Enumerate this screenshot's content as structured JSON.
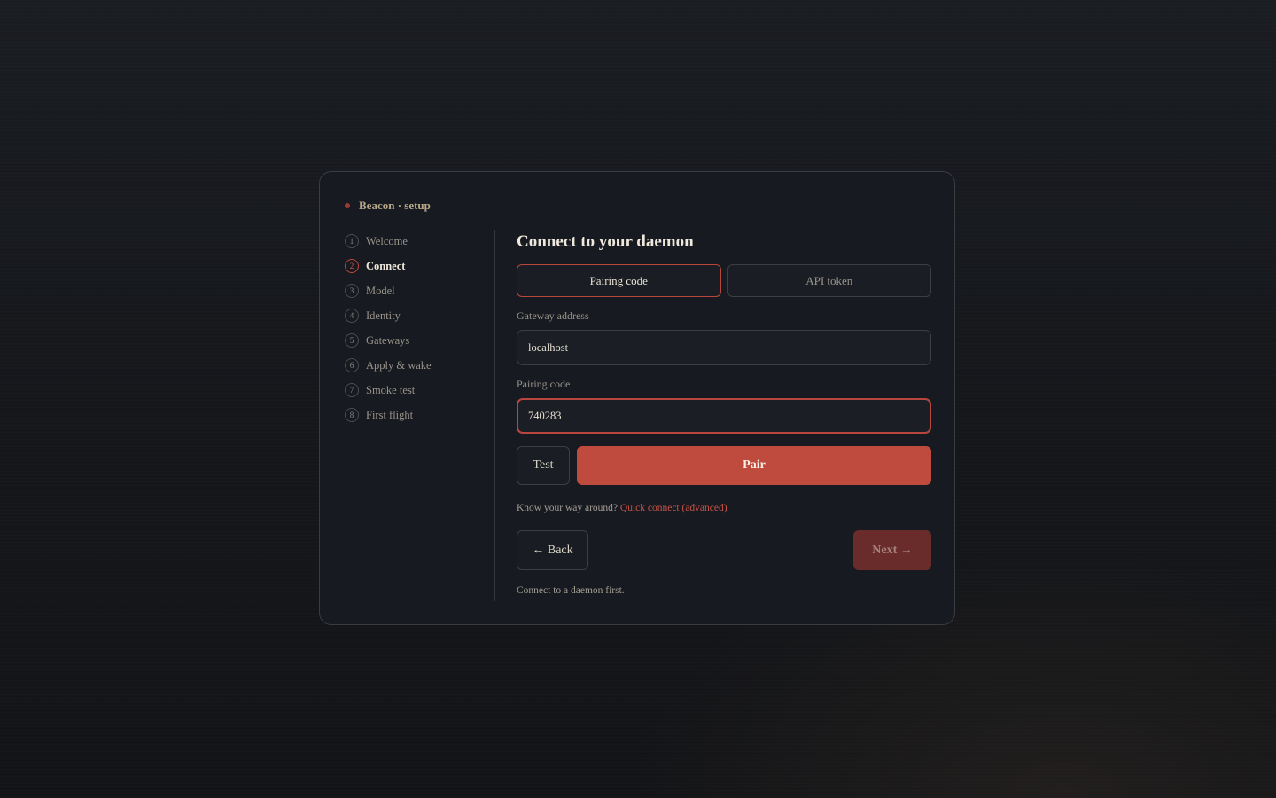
{
  "brand": {
    "title": "Beacon · setup"
  },
  "steps": [
    {
      "num": "1",
      "label": "Welcome"
    },
    {
      "num": "2",
      "label": "Connect"
    },
    {
      "num": "3",
      "label": "Model"
    },
    {
      "num": "4",
      "label": "Identity"
    },
    {
      "num": "5",
      "label": "Gateways"
    },
    {
      "num": "6",
      "label": "Apply & wake"
    },
    {
      "num": "7",
      "label": "Smoke test"
    },
    {
      "num": "8",
      "label": "First flight"
    }
  ],
  "active_step": "Connect",
  "main": {
    "title": "Connect to your daemon",
    "tabs": [
      {
        "label": "Pairing code",
        "active": true
      },
      {
        "label": "API token",
        "active": false
      }
    ],
    "gateway": {
      "label": "Gateway address",
      "value": "localhost"
    },
    "pairing": {
      "label": "Pairing code",
      "value": "740283"
    },
    "test_label": "Test",
    "pair_label": "Pair",
    "hint_text": "Know your way around?",
    "hint_link": "Quick connect (advanced)",
    "back_label": "← Back",
    "next_label": "Next →",
    "status": "Connect to a daemon first."
  },
  "colors": {
    "accent": "#bf4a3e",
    "accent_disabled": "#6a2c2a",
    "card_bg": "#171a20",
    "page_bg": "#15171b"
  }
}
